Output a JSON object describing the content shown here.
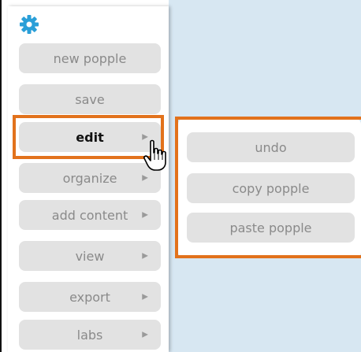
{
  "menu": {
    "items": [
      {
        "label": "new popple",
        "has_submenu": false,
        "active": false
      },
      {
        "label": "save",
        "has_submenu": false,
        "active": false
      },
      {
        "label": "edit",
        "has_submenu": true,
        "active": true
      },
      {
        "label": "organize",
        "has_submenu": true,
        "active": false
      },
      {
        "label": "add content",
        "has_submenu": true,
        "active": false
      },
      {
        "label": "view",
        "has_submenu": true,
        "active": false
      },
      {
        "label": "export",
        "has_submenu": true,
        "active": false
      },
      {
        "label": "labs",
        "has_submenu": true,
        "active": false
      }
    ],
    "arrow_glyph": "▶"
  },
  "submenu": {
    "items": [
      {
        "label": "undo"
      },
      {
        "label": "copy popple"
      },
      {
        "label": "paste popple"
      }
    ]
  },
  "icons": {
    "settings": "gear-icon",
    "cursor": "hand-pointer-icon"
  },
  "colors": {
    "highlight": "#e2721c",
    "gear": "#2a9fd8",
    "canvas": "#d7e7f2",
    "button": "#e2e2e2"
  }
}
